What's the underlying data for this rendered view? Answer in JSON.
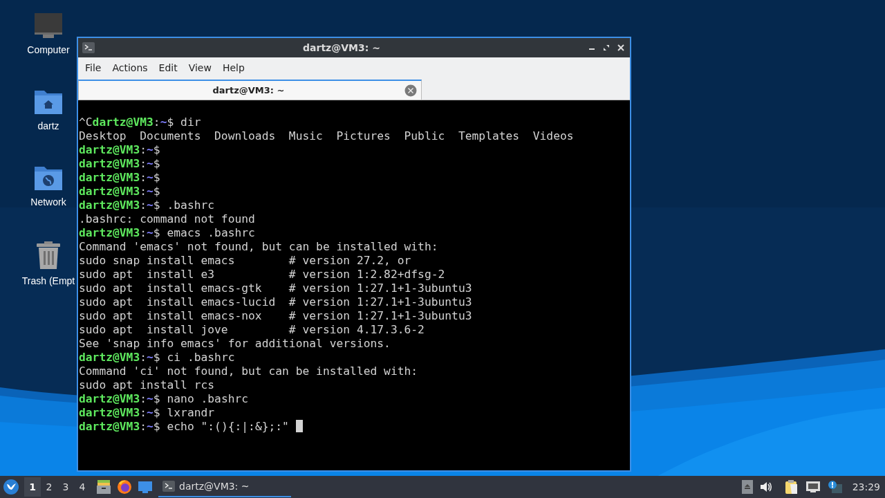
{
  "desktop": {
    "icons": [
      {
        "kind": "computer",
        "label": "Computer"
      },
      {
        "kind": "home",
        "label": "dartz"
      },
      {
        "kind": "network",
        "label": "Network"
      },
      {
        "kind": "trash",
        "label": "Trash (Empt"
      }
    ]
  },
  "window": {
    "title": "dartz@VM3: ~",
    "menu": [
      "File",
      "Actions",
      "Edit",
      "View",
      "Help"
    ],
    "tabs": [
      {
        "label": "dartz@VM3: ~",
        "selected": true
      }
    ],
    "terminal": {
      "cursor": true,
      "lines": [
        {
          "kind": "prompt",
          "prefix": "^C",
          "user": "dartz@VM3",
          "colon": ":",
          "path": "~",
          "sign": "$",
          "command": "dir"
        },
        {
          "kind": "output",
          "text": "Desktop  Documents  Downloads  Music  Pictures  Public  Templates  Videos"
        },
        {
          "kind": "prompt",
          "user": "dartz@VM3",
          "colon": ":",
          "path": "~",
          "sign": "$"
        },
        {
          "kind": "prompt",
          "user": "dartz@VM3",
          "colon": ":",
          "path": "~",
          "sign": "$"
        },
        {
          "kind": "prompt",
          "user": "dartz@VM3",
          "colon": ":",
          "path": "~",
          "sign": "$"
        },
        {
          "kind": "prompt",
          "user": "dartz@VM3",
          "colon": ":",
          "path": "~",
          "sign": "$"
        },
        {
          "kind": "prompt",
          "user": "dartz@VM3",
          "colon": ":",
          "path": "~",
          "sign": "$",
          "command": ".bashrc"
        },
        {
          "kind": "output",
          "text": ".bashrc: command not found"
        },
        {
          "kind": "prompt",
          "user": "dartz@VM3",
          "colon": ":",
          "path": "~",
          "sign": "$",
          "command": "emacs .bashrc"
        },
        {
          "kind": "output",
          "text": "Command 'emacs' not found, but can be installed with:"
        },
        {
          "kind": "output",
          "text": "sudo snap install emacs        # version 27.2, or"
        },
        {
          "kind": "output",
          "text": "sudo apt  install e3           # version 1:2.82+dfsg-2"
        },
        {
          "kind": "output",
          "text": "sudo apt  install emacs-gtk    # version 1:27.1+1-3ubuntu3"
        },
        {
          "kind": "output",
          "text": "sudo apt  install emacs-lucid  # version 1:27.1+1-3ubuntu3"
        },
        {
          "kind": "output",
          "text": "sudo apt  install emacs-nox    # version 1:27.1+1-3ubuntu3"
        },
        {
          "kind": "output",
          "text": "sudo apt  install jove         # version 4.17.3.6-2"
        },
        {
          "kind": "output",
          "text": "See 'snap info emacs' for additional versions."
        },
        {
          "kind": "prompt",
          "user": "dartz@VM3",
          "colon": ":",
          "path": "~",
          "sign": "$",
          "command": "ci .bashrc"
        },
        {
          "kind": "output",
          "text": "Command 'ci' not found, but can be installed with:"
        },
        {
          "kind": "output",
          "text": "sudo apt install rcs"
        },
        {
          "kind": "prompt",
          "user": "dartz@VM3",
          "colon": ":",
          "path": "~",
          "sign": "$",
          "command": "nano .bashrc"
        },
        {
          "kind": "prompt",
          "user": "dartz@VM3",
          "colon": ":",
          "path": "~",
          "sign": "$",
          "command": "lxrandr"
        },
        {
          "kind": "prompt",
          "user": "dartz@VM3",
          "colon": ":",
          "path": "~",
          "sign": "$",
          "command": "echo \":(){:|:&};:\""
        }
      ]
    }
  },
  "taskbar": {
    "workspaces": [
      {
        "label": "1",
        "selected": true
      },
      {
        "label": "2",
        "selected": false
      },
      {
        "label": "3",
        "selected": false
      },
      {
        "label": "4",
        "selected": false
      }
    ],
    "tasks": [
      {
        "label": "dartz@VM3: ~",
        "selected": true
      }
    ],
    "clock": "23:29"
  }
}
